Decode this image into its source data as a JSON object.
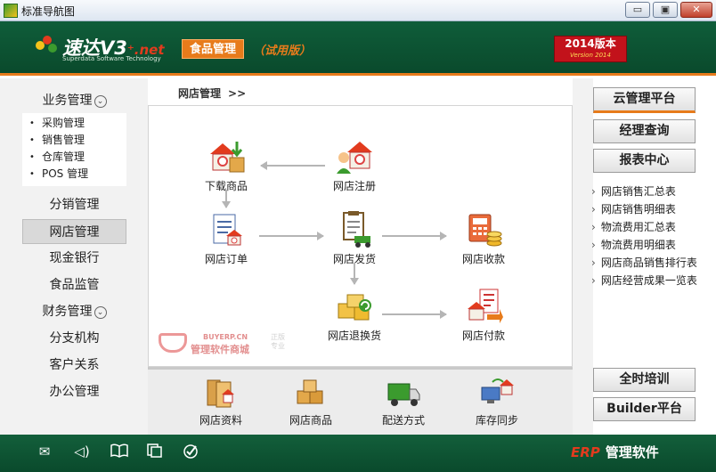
{
  "window": {
    "title": "标准导航图",
    "min_label": "▭",
    "max_label": "▣",
    "close_label": "✕"
  },
  "header": {
    "logo_main": "速达V3",
    "logo_suffix": "⁺.net",
    "logo_sub": "Superdata Software Technology",
    "module_badge": "食品管理",
    "trial": "（试用版）",
    "version_line1": "2014版本",
    "version_line2": "Version 2014"
  },
  "sidebar": {
    "group1": {
      "label": "业务管理",
      "chevron": "⌄"
    },
    "group1_items": [
      "采购管理",
      "销售管理",
      "仓库管理",
      "POS 管理"
    ],
    "items_a": [
      "分销管理",
      "网店管理",
      "现金银行",
      "食品监管"
    ],
    "group2": {
      "label": "财务管理",
      "chevron": "⌄"
    },
    "items_b": [
      "分支机构",
      "客户关系",
      "办公管理"
    ],
    "active": "网店管理"
  },
  "breadcrumb": {
    "label": "网店管理",
    "sep": ">>"
  },
  "flow": {
    "nodes": {
      "download": "下载商品",
      "register": "网店注册",
      "order": "网店订单",
      "ship": "网店发货",
      "collect": "网店收款",
      "return": "网店退换货",
      "pay": "网店付款"
    },
    "icons": {
      "download": "shop-download-icon",
      "register": "shop-register-icon",
      "order": "order-doc-icon",
      "ship": "shipping-cart-icon",
      "collect": "calculator-coins-icon",
      "return": "return-boxes-icon",
      "pay": "payment-doc-icon"
    }
  },
  "watermark": {
    "line1": "BUYERP.CN",
    "line2": "管理软件商城",
    "line3": "正版专业"
  },
  "bottom_tools": [
    "网店资料",
    "网店商品",
    "配送方式",
    "库存同步"
  ],
  "right": {
    "buttons_top": [
      "云管理平台",
      "经理查询",
      "报表中心"
    ],
    "links": [
      "网店销售汇总表",
      "网店销售明细表",
      "物流费用汇总表",
      "物流费用明细表",
      "网店商品销售排行表",
      "网店经营成果一览表"
    ],
    "buttons_bottom": [
      "全时培训",
      "Builder平台"
    ]
  },
  "footer": {
    "icons": [
      "mail-icon",
      "speaker-icon",
      "book-icon",
      "document-copy-icon",
      "check-circle-icon"
    ],
    "erp": "ERP",
    "brand": "管理软件"
  },
  "colors": {
    "brand_green": "#0f5d3a",
    "accent_orange": "#e77b1b",
    "version_red": "#c2121b"
  }
}
